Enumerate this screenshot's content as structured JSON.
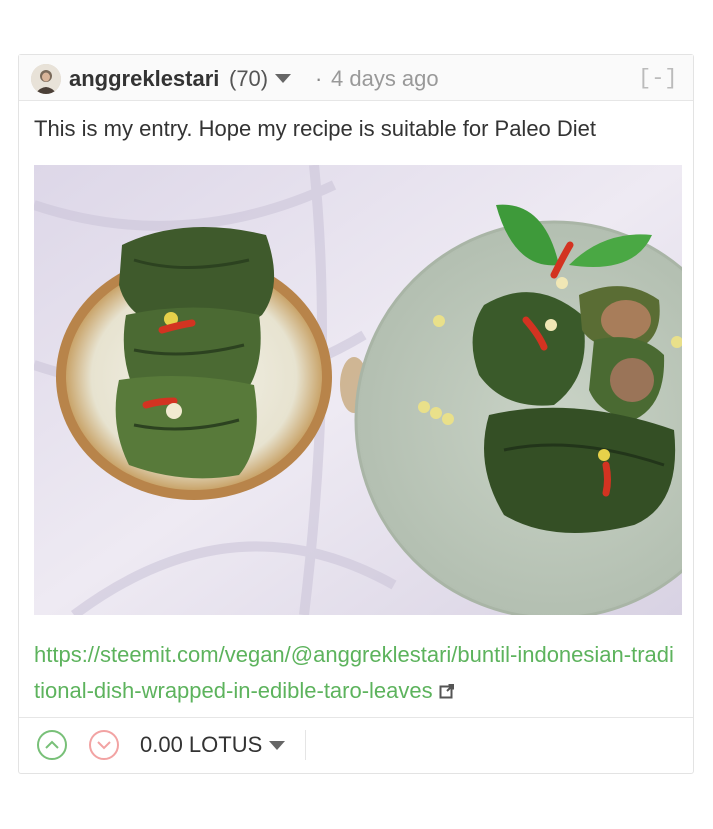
{
  "comment": {
    "author": "anggreklestari",
    "reputation": "(70)",
    "separator": "·",
    "time_ago": "4 days ago",
    "collapse_label": "[-]",
    "body_text": "This is my entry. Hope my recipe is suitable for Paleo Diet",
    "link_text": "https://steemit.com/vegan/@anggreklestari/buntil-indonesian-traditional-dish-wrapped-in-edible-taro-leaves",
    "payout": "0.00 LOTUS"
  },
  "icons": {
    "avatar": "user-avatar",
    "author_menu": "chevron-down-icon",
    "external_link": "external-link-icon",
    "upvote": "upvote-icon",
    "downvote": "downvote-icon",
    "payout_menu": "chevron-down-icon"
  },
  "colors": {
    "link": "#5db35d",
    "upvote": "#78c078",
    "downvote": "#f2a3a3"
  }
}
